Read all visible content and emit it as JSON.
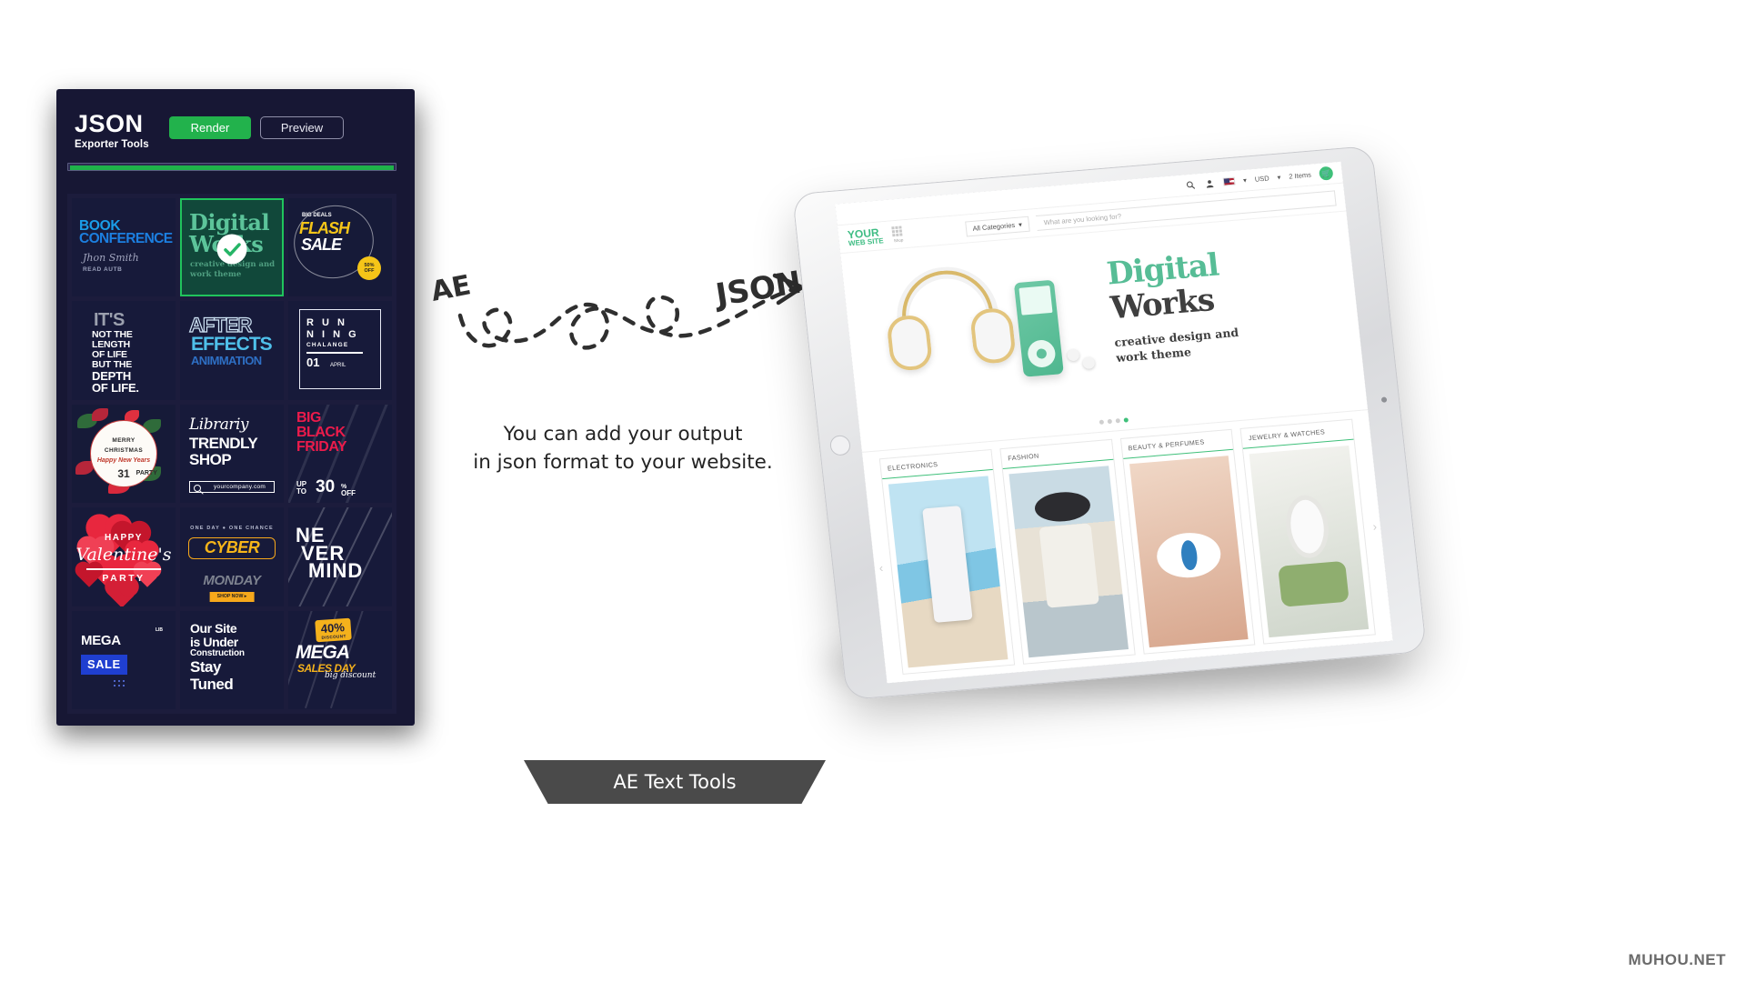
{
  "app": {
    "brand_line1": "JSON",
    "brand_line2": "Exporter Tools",
    "render_label": "Render",
    "preview_label": "Preview",
    "progress_percent": 99
  },
  "templates": [
    {
      "name": "book-conference",
      "lines": [
        "BOOK",
        "CONFERENCE"
      ],
      "signature": "Jhon Smith",
      "cta": "READ AUTB",
      "selected": false
    },
    {
      "name": "digital-works",
      "lines": [
        "Digital",
        "Works"
      ],
      "subtitle": "creative design and work theme",
      "selected": true
    },
    {
      "name": "flash-sale",
      "kicker": "BIG DEALS",
      "lines": [
        "FLASH",
        "SALE"
      ],
      "badge1": "50%",
      "badge2": "OFF",
      "selected": false
    },
    {
      "name": "depth-of-life",
      "lead": "IT'S",
      "lines": [
        "NOT THE",
        "LENGTH",
        "OF LIFE",
        "BUT THE",
        "DEPTH",
        "OF LIFE."
      ],
      "selected": false
    },
    {
      "name": "after-effects",
      "lines": [
        "AFTER",
        "EFFECTS",
        "ANIMMATION"
      ],
      "selected": false
    },
    {
      "name": "running-chalange",
      "l1": "R U N",
      "l2": "N I N G",
      "l3": "CHALANGE",
      "day": "01",
      "month": "APRIL",
      "selected": false
    },
    {
      "name": "merry-christmas",
      "l1": "MERRY",
      "l2": "CHRISTMAS",
      "l3": "Happy New Years",
      "l4": "31",
      "l5": "PARTY",
      "selected": false
    },
    {
      "name": "trendly-shop",
      "script": "Librariy",
      "l1": "TRENDLY",
      "l2": "SHOP",
      "url": "yourcompany.com",
      "selected": false
    },
    {
      "name": "big-black-friday",
      "lines": [
        "BIG",
        "BLACK",
        "FRIDAY"
      ],
      "up": "UP",
      "to": "TO",
      "num": "30",
      "pc": "%",
      "off": "OFF",
      "selected": false
    },
    {
      "name": "valentines-party",
      "l1": "HAPPY",
      "l2": "Valentine's",
      "l3": "PARTY",
      "selected": false
    },
    {
      "name": "cyber-monday",
      "kicker": "ONE DAY ● ONE CHANCE",
      "l1": "CYBER",
      "l2": "MONDAY",
      "cta": "SHOP NOW ▸",
      "selected": false
    },
    {
      "name": "never-mind",
      "l1": "NE",
      "l2": "VER",
      "l3": "MIND",
      "selected": false
    },
    {
      "name": "mega-sale",
      "l1": "MEGA",
      "l2": "SALE",
      "tag": "LIB",
      "selected": false
    },
    {
      "name": "under-construction",
      "l1": "Our Site",
      "l2": "is Under",
      "l3": "Construction",
      "l4": "Stay",
      "l5": "Tuned",
      "selected": false
    },
    {
      "name": "mega-sales-day",
      "discount": "40%",
      "discount_label": "DISCOUNT",
      "l1": "MEGA",
      "l2": "SALES DAY",
      "l3": "big discount",
      "selected": false
    }
  ],
  "center": {
    "from_label": "AE",
    "to_label": "JSON",
    "caption_line1": "You can add your output",
    "caption_line2": "in json format to your website."
  },
  "tablet": {
    "topbar": {
      "currency": "USD",
      "cart_count": "2 Items",
      "search_icon": "search-icon",
      "account_icon": "user-icon",
      "flag_icon": "us-flag-icon",
      "cart_icon": "cart-icon"
    },
    "logo_line1": "YOUR",
    "logo_line2": "WEB SITE",
    "shop_label": "Shop",
    "category_select": "All Categories",
    "search_placeholder": "What are you looking for?",
    "hero": {
      "title_line1": "Digital",
      "title_line2": "Works",
      "subtitle_line1": "creative design and",
      "subtitle_line2": "work theme",
      "slides": 4,
      "active_slide": 4
    },
    "categories": [
      {
        "label": "ELECTRONICS"
      },
      {
        "label": "FASHION"
      },
      {
        "label": "BEAUTY & PERFUMES"
      },
      {
        "label": "JEWELRY & WATCHES"
      }
    ],
    "prev_arrow": "‹",
    "next_arrow": "›"
  },
  "footer": {
    "tab_label": "AE Text Tools",
    "watermark": "MUHOU.NET"
  },
  "colors": {
    "panel_bg": "#171734",
    "accent_green": "#22b24c",
    "selected_green": "#20c45c",
    "tile_bg": "#171a3a",
    "hero_green": "#57bd96"
  }
}
